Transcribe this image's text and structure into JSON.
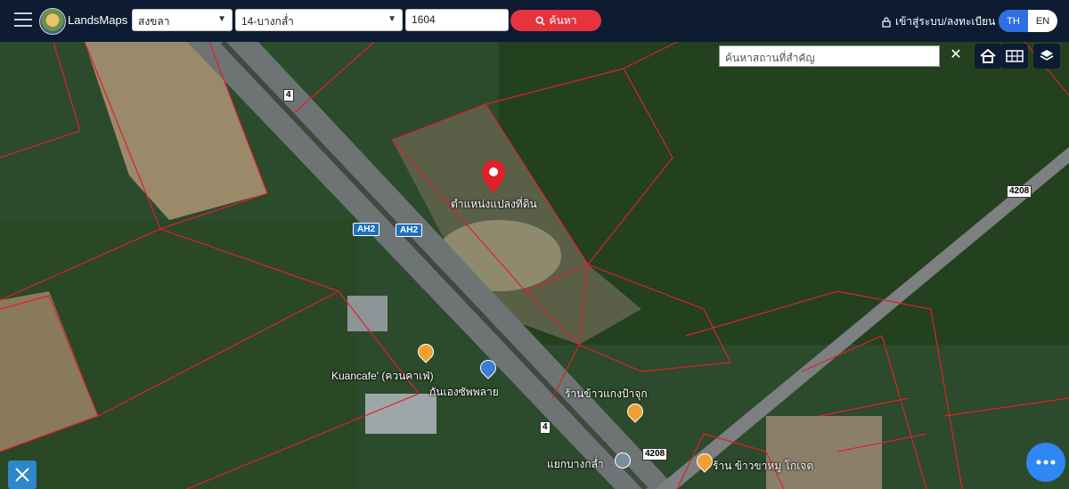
{
  "header": {
    "brand": "LandsMaps",
    "province_select": "สงขลา",
    "district_select": "14-บางกล่ำ",
    "parcel_input": "1604",
    "search_button": "ค้นหา",
    "login_label": "เข้าสู่ระบบ/ลงทะเบียน",
    "lang_th": "TH",
    "lang_en": "EN"
  },
  "map_controls": {
    "place_search_placeholder": "ค้นหาสถานที่สำคัญ",
    "clear_label": "✕"
  },
  "map": {
    "parcel_pin_label": "ตำแหน่งแปลงที่ดิน",
    "road_shield_4_top": "4",
    "road_shield_4_bottom": "4",
    "road_shield_4208_right": "4208",
    "road_shield_4208_bottom": "4208",
    "ah2_a": "AH2",
    "ah2_b": "AH2",
    "poi_kuancafe": "Kuancafe' (ควนคาเฟ่)",
    "poi_pharmacy": "กันเองซัพพลาย",
    "poi_restaurant1": "ร้านข้าวแกงป้าจุก",
    "poi_junction": "แยกบางกล่ำ",
    "poi_restaurant2": "ร้าน ข้าวขาหมู โกเจต"
  },
  "colors": {
    "topbar": "#0d1b33",
    "search_button": "#e6343f",
    "lang_active": "#2f6ee3",
    "parcel_lines": "#e0202a",
    "pin": "#e0202a",
    "fab": "#2f86f5"
  },
  "icons": {
    "menu": "hamburger-icon",
    "search": "search-icon",
    "lock": "lock-icon",
    "home": "home-icon",
    "grid": "grid-icon",
    "layers": "layers-icon",
    "pin": "map-pin-icon",
    "chat": "chat-icon",
    "tool": "ruler-tool-icon"
  }
}
